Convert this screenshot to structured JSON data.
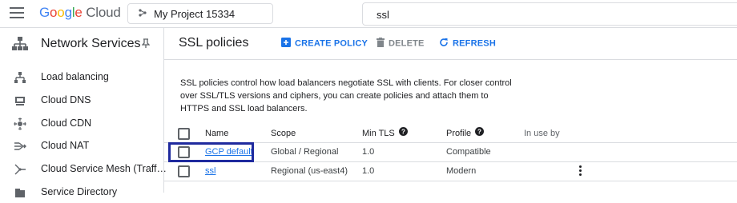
{
  "header": {
    "logo": {
      "letters": [
        "G",
        "o",
        "o",
        "g",
        "l",
        "e"
      ],
      "cloud": "Cloud"
    },
    "project_label": "My Project 15334",
    "search_value": "ssl"
  },
  "sidebar": {
    "title": "Network Services",
    "items": [
      {
        "label": "Load balancing",
        "icon": "load-balancing-icon"
      },
      {
        "label": "Cloud DNS",
        "icon": "dns-icon"
      },
      {
        "label": "Cloud CDN",
        "icon": "cdn-icon"
      },
      {
        "label": "Cloud NAT",
        "icon": "nat-icon"
      },
      {
        "label": "Cloud Service Mesh (Traff…",
        "icon": "service-mesh-icon"
      },
      {
        "label": "Service Directory",
        "icon": "service-directory-icon"
      }
    ]
  },
  "main": {
    "title": "SSL policies",
    "toolbar": {
      "create": "CREATE POLICY",
      "delete": "DELETE",
      "refresh": "REFRESH"
    },
    "description": "SSL policies control how load balancers negotiate SSL with clients. For closer control over SSL/TLS versions and ciphers, you can create policies and attach them to HTTPS and SSL load balancers.",
    "table": {
      "headers": {
        "name": "Name",
        "scope": "Scope",
        "min_tls": "Min TLS",
        "profile": "Profile",
        "in_use_by": "In use by"
      },
      "rows": [
        {
          "name": "GCP default",
          "scope": "Global / Regional",
          "min_tls": "1.0",
          "profile": "Compatible",
          "in_use_by": ""
        },
        {
          "name": "ssl",
          "scope": "Regional (us-east4)",
          "min_tls": "1.0",
          "profile": "Modern",
          "in_use_by": ""
        }
      ]
    }
  },
  "colors": {
    "accent": "#1a73e8",
    "highlight": "#1f2a9e",
    "border": "#dadce0"
  }
}
